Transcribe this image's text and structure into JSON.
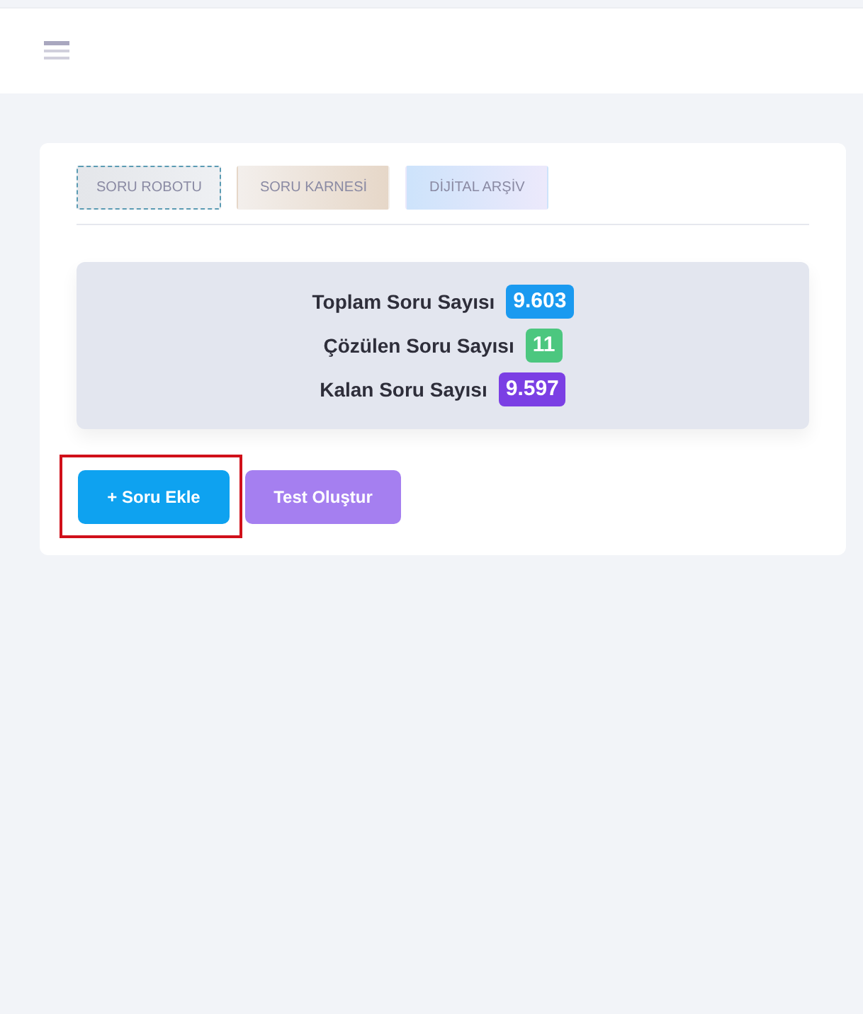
{
  "tabs": [
    {
      "label": "SORU ROBOTU",
      "selected": true,
      "kind": "gray"
    },
    {
      "label": "SORU KARNESİ",
      "selected": false,
      "kind": "beige"
    },
    {
      "label": "DİJİTAL ARŞİV",
      "selected": false,
      "kind": "blue"
    }
  ],
  "stats": [
    {
      "label": "Toplam Soru Sayısı",
      "value": "9.603",
      "color": "#1a9af0"
    },
    {
      "label": "Çözülen Soru Sayısı",
      "value": "11",
      "color": "#4cc77f"
    },
    {
      "label": "Kalan Soru Sayısı",
      "value": "9.597",
      "color": "#7b3fe4"
    }
  ],
  "buttons": [
    {
      "label": "+ Soru Ekle",
      "kind": "primary",
      "highlighted": true
    },
    {
      "label": "Test Oluştur",
      "kind": "secondary",
      "highlighted": false
    }
  ]
}
